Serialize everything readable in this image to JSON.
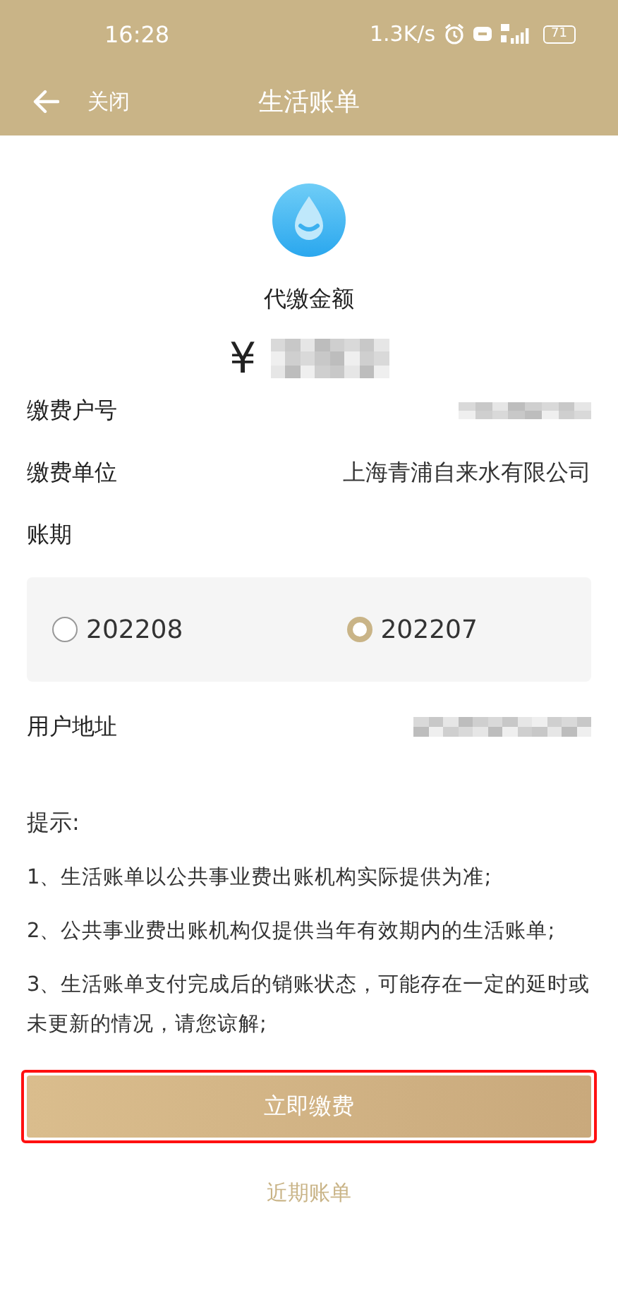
{
  "status_bar": {
    "time": "16:28",
    "speed": "1.3K/s",
    "battery": "71"
  },
  "nav": {
    "back_label": "关闭",
    "title": "生活账单"
  },
  "amount": {
    "label": "代缴金额",
    "currency": "¥"
  },
  "fields": [
    {
      "kind": "redacted",
      "label": "缴费户号"
    },
    {
      "kind": "text",
      "label": "缴费单位",
      "value": "上海青浦自来水有限公司"
    }
  ],
  "period": {
    "label": "账期",
    "options": [
      {
        "label": "202208",
        "selected": false
      },
      {
        "label": "202207",
        "selected": true
      }
    ]
  },
  "address": {
    "label": "用户地址"
  },
  "tips": {
    "title": "提示:",
    "items": [
      "1、生活账单以公共事业费出账机构实际提供为准;",
      "2、公共事业费出账机构仅提供当年有效期内的生活账单;",
      "3、生活账单支付完成后的销账状态，可能存在一定的延时或未更新的情况，请您谅解;"
    ]
  },
  "pay_button": {
    "label": "立即缴费",
    "highlighted": true
  },
  "recent_link": {
    "label": "近期账单"
  }
}
